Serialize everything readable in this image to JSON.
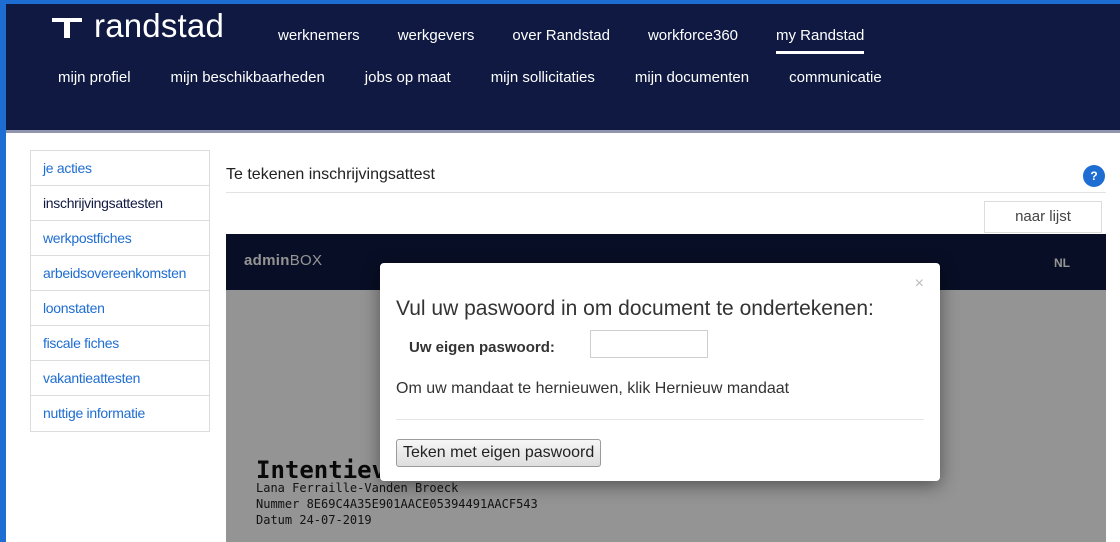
{
  "brand": {
    "name": "randstad"
  },
  "main_nav": [
    {
      "label": "werknemers",
      "active": false
    },
    {
      "label": "werkgevers",
      "active": false
    },
    {
      "label": "over Randstad",
      "active": false
    },
    {
      "label": "workforce360",
      "active": false
    },
    {
      "label": "my Randstad",
      "active": true
    }
  ],
  "sub_nav": [
    {
      "label": "mijn profiel",
      "bold": false
    },
    {
      "label": "mijn beschikbaarheden",
      "bold": false
    },
    {
      "label": "jobs op maat",
      "bold": false
    },
    {
      "label": "mijn sollicitaties",
      "bold": false
    },
    {
      "label": "mijn documenten",
      "bold": true
    },
    {
      "label": "communicatie",
      "bold": false
    }
  ],
  "sidebar": {
    "items": [
      {
        "label": "je acties",
        "active": false
      },
      {
        "label": "inschrijvingsattesten",
        "active": true
      },
      {
        "label": "werkpostfiches",
        "active": false
      },
      {
        "label": "arbeidsovereenkomsten",
        "active": false
      },
      {
        "label": "loonstaten",
        "active": false
      },
      {
        "label": "fiscale fiches",
        "active": false
      },
      {
        "label": "vakantieattesten",
        "active": false
      },
      {
        "label": "nuttige informatie",
        "active": false
      }
    ]
  },
  "main": {
    "title": "Te tekenen inschrijvingsattest",
    "help_icon": "?",
    "list_button": "naar lijst"
  },
  "adminbox": {
    "title_bold": "admin",
    "title_rest": "BOX",
    "language": "NL"
  },
  "document": {
    "heading": "Intentieve",
    "name": "Lana Ferraille-Vanden Broeck",
    "number": "Nummer 8E69C4A35E901AACE05394491AACF543",
    "date": "Datum 24-07-2019"
  },
  "modal": {
    "close_symbol": "×",
    "title": "Vul uw paswoord in om document te ondertekenen:",
    "password_label": "Uw eigen paswoord:",
    "password_value": "",
    "mandate_text": "Om uw mandaat te hernieuwen, klik ",
    "mandate_link": "Hernieuw mandaat",
    "sign_button": "Teken met eigen paswoord"
  },
  "colors": {
    "header_bg": "#0f1941",
    "accent_blue": "#1e6dd2",
    "link_blue": "#1e6dd2"
  },
  "icons": {
    "logo": "randstad-logo-icon",
    "help": "question-icon",
    "close": "close-icon"
  }
}
